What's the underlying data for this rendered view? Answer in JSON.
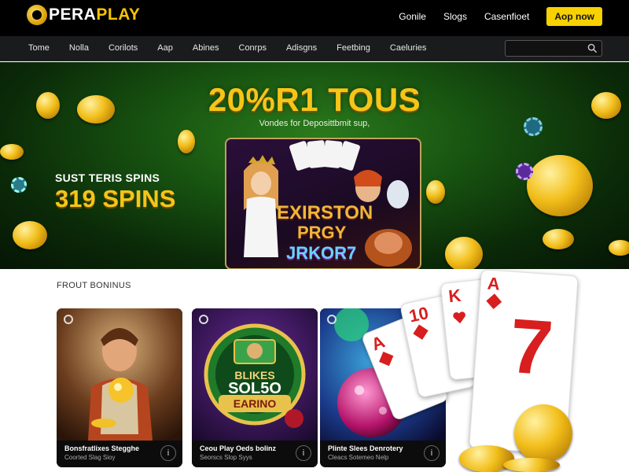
{
  "header": {
    "logo_prefix": "PERA",
    "logo_suffix": "PLAY",
    "links": [
      "Gonile",
      "Slogs",
      "Casenfioet"
    ],
    "cta_label": "Aop now"
  },
  "nav": {
    "items": [
      "Tome",
      "Nolla",
      "Corilots",
      "Aap",
      "Abines",
      "Conrps",
      "Adisgns",
      "Feetbing",
      "Caeluries"
    ],
    "search_placeholder": "",
    "search_icon": "search-icon"
  },
  "hero": {
    "title": "20%R1 TOUS",
    "subtitle": "Vondes for Deposittbmit sup,",
    "spins_small": "SUST TERIS SPINS",
    "spins_big": "319 SPINS",
    "promo_title": "EXIRSTON",
    "promo_sub": "PRGY",
    "promo_num": "JRKOR7"
  },
  "section": {
    "title": "FROUT BONINUS"
  },
  "games": [
    {
      "name": "Bonsfratlixes Stegghe",
      "provider": "Coorted Slag Sioy"
    },
    {
      "name": "Ceou Play Oeds bolinz",
      "provider": "Seorscs Slop Syys"
    },
    {
      "name": "Plinte Slees Denrotery",
      "provider": "Cleacs Sotemeo Nelp"
    }
  ],
  "game_art": {
    "card2_line1": "BLIKES",
    "card2_line2": "SOL5O",
    "card2_line3": "EARINO"
  },
  "playing_cards": [
    "A",
    "10",
    "K",
    "A",
    "7"
  ],
  "colors": {
    "accent": "#f7d100",
    "gold": "#f5c518",
    "hero_green": "#185511",
    "header_bg": "#000000",
    "nav_bg": "#1a1b1d"
  }
}
